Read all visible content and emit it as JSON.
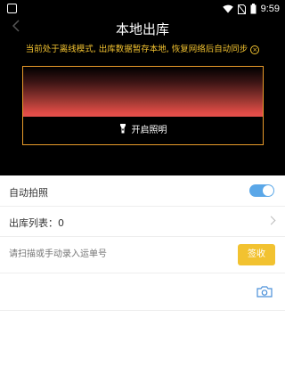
{
  "status_bar": {
    "time": "9:59",
    "icons": [
      "wifi-icon",
      "no-sim-icon",
      "battery-icon"
    ]
  },
  "header": {
    "title": "本地出库",
    "notice": "当前处于离线模式, 出库数据暂存本地, 恢复网络后自动同步",
    "notice_close": "×"
  },
  "scanner": {
    "flash_label": "开启照明"
  },
  "settings": {
    "auto_photo_label": "自动拍照",
    "auto_photo_on": true,
    "outbound_list_label": "出库列表：0"
  },
  "input": {
    "placeholder": "请扫描或手动录入运单号",
    "value": "",
    "submit_label": "签收"
  },
  "colors": {
    "accent_yellow": "#f2c230",
    "scan_frame": "#e89a2a",
    "toggle_blue": "#5aa7e8",
    "camera_blue": "#4a90d9"
  }
}
